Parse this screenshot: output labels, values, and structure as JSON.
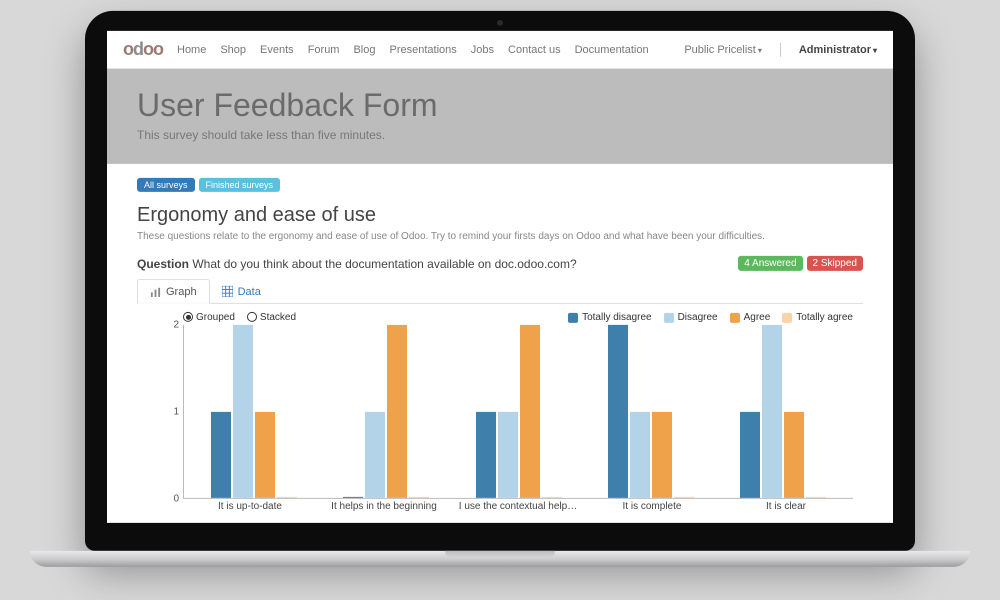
{
  "brand": "odoo",
  "nav": {
    "items": [
      "Home",
      "Shop",
      "Events",
      "Forum",
      "Blog",
      "Presentations",
      "Jobs",
      "Contact us",
      "Documentation"
    ],
    "pricelist": "Public Pricelist",
    "admin": "Administrator"
  },
  "hero": {
    "title": "User Feedback Form",
    "subtitle": "This survey should take less than five minutes."
  },
  "filters": {
    "all": "All surveys",
    "finished": "Finished surveys"
  },
  "section": {
    "title": "Ergonomy and ease of use",
    "desc": "These questions relate to the ergonomy and ease of use of Odoo. Try to remind your firsts days on Odoo and what have been your difficulties."
  },
  "question": {
    "label": "Question",
    "text": "What do you think about the documentation available on doc.odoo.com?",
    "answered_label": "4 Answered",
    "skipped_label": "2 Skipped"
  },
  "tabs": {
    "graph": "Graph",
    "data": "Data"
  },
  "chart_toggle": {
    "grouped": "Grouped",
    "stacked": "Stacked"
  },
  "legend": {
    "totally_disagree": "Totally disagree",
    "disagree": "Disagree",
    "agree": "Agree",
    "totally_agree": "Totally agree"
  },
  "colors": {
    "totally_disagree": "#3f7fab",
    "disagree": "#b3d4e8",
    "agree": "#f0a24b",
    "totally_agree": "#f8d3a6"
  },
  "chart_data": {
    "type": "bar",
    "title": "What do you think about the documentation available on doc.odoo.com?",
    "xlabel": "",
    "ylabel": "",
    "ylim": [
      0,
      2
    ],
    "y_ticks": [
      0,
      1,
      2
    ],
    "categories": [
      "It is up-to-date",
      "It helps in the beginning",
      "I use the contextual help…",
      "It is complete",
      "It is clear"
    ],
    "series": [
      {
        "name": "Totally disagree",
        "color": "#3f7fab",
        "values": [
          1,
          0,
          1,
          2,
          1
        ]
      },
      {
        "name": "Disagree",
        "color": "#b3d4e8",
        "values": [
          2,
          1,
          1,
          1,
          2
        ]
      },
      {
        "name": "Agree",
        "color": "#f0a24b",
        "values": [
          1,
          2,
          2,
          1,
          1
        ]
      },
      {
        "name": "Totally agree",
        "color": "#f8d3a6",
        "values": [
          0,
          0,
          0,
          0,
          0
        ]
      }
    ]
  }
}
